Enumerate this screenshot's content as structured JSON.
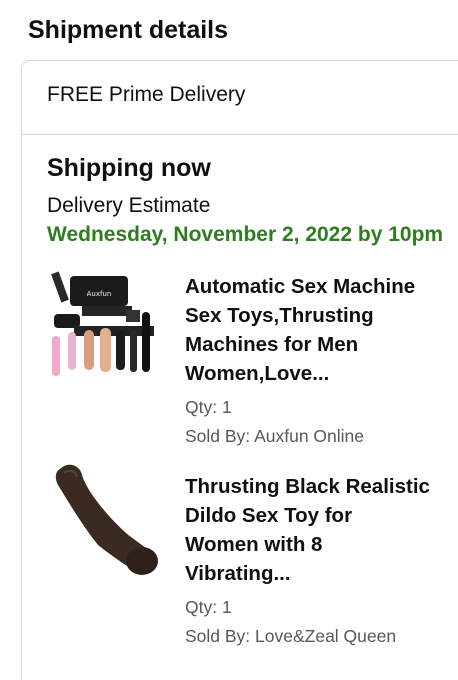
{
  "header": {
    "title": "Shipment details"
  },
  "delivery": {
    "label": "FREE Prime Delivery"
  },
  "shipping": {
    "status": "Shipping now",
    "estimate_label": "Delivery Estimate",
    "estimate_date": "Wednesday, November 2, 2022 by 10pm"
  },
  "items": [
    {
      "title_lines": [
        "Automatic Sex Machine",
        "Sex Toys,Thrusting",
        "Machines for Men",
        "Women,Love..."
      ],
      "qty": "Qty: 1",
      "seller": "Sold By: Auxfun Online",
      "image_brand_text": "Auxfun"
    },
    {
      "title_lines": [
        "Thrusting Black Realistic",
        "Dildo Sex Toy for",
        "Women with 8",
        "Vibrating..."
      ],
      "qty": "Qty: 1",
      "seller": "Sold By: Love&Zeal Queen"
    }
  ],
  "colors": {
    "delivery_date": "#2e7d1f",
    "secondary_text": "#565959",
    "border": "#d5d9d9"
  }
}
